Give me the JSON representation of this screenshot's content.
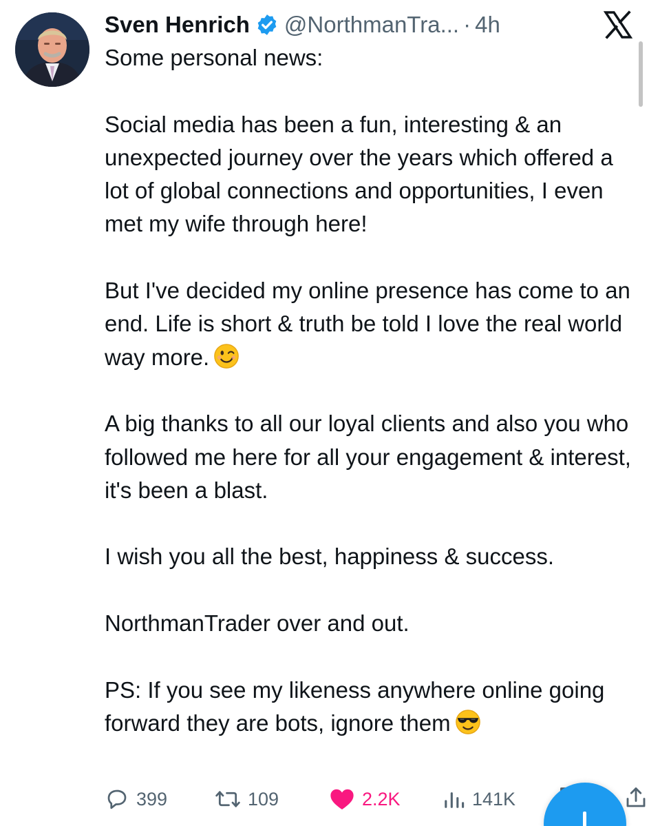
{
  "author": {
    "name": "Sven Henrich",
    "handle": "@NorthmanTra...",
    "separator": "·",
    "time": "4h"
  },
  "icons": {
    "verified": "verified-badge-icon",
    "platform": "x-logo-icon",
    "avatar": "profile-photo"
  },
  "tweet": {
    "paragraphs": [
      "Some personal news:",
      "Social media has been a fun, interesting & an unexpected journey over the years which offered a lot of global connections and opportunities, I even met my wife through here!",
      "But I've decided my online presence has come to an end. Life is short & truth be told I love the real world way more.",
      "A big thanks to all our loyal clients and also you who followed me here for all your engagement & interest, it's been a blast.",
      "I wish you all the best, happiness & success.",
      "NorthmanTrader over and out.",
      "PS: If you see my likeness anywhere online going forward they are bots, ignore them"
    ],
    "emojis": [
      "winking-face",
      "smiling-face-with-sunglasses"
    ]
  },
  "actions": {
    "replies": "399",
    "reposts": "109",
    "likes": "2.2K",
    "views": "141K"
  },
  "colors": {
    "text": "#0f1419",
    "secondary": "#536471",
    "verified": "#1d9bf0",
    "like": "#f91880",
    "fab": "#1d9bf0"
  }
}
